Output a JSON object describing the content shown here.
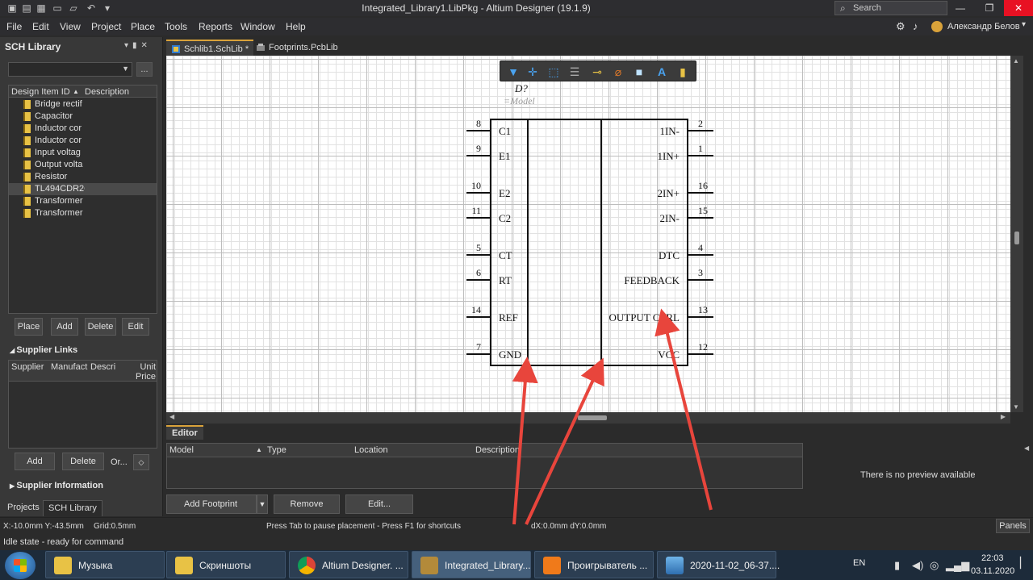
{
  "window": {
    "title": "Integrated_Library1.LibPkg - Altium Designer (19.1.9)",
    "search_placeholder": "Search",
    "min": "—",
    "restore": "❐",
    "close": "✕"
  },
  "menu": {
    "items": [
      "File",
      "Edit",
      "View",
      "Project",
      "Place",
      "Tools",
      "Reports",
      "Window",
      "Help"
    ],
    "user": "Александр Белов"
  },
  "left_panel": {
    "title": "SCH Library",
    "dots": "...",
    "columns": [
      "Design Item ID",
      "Description"
    ],
    "items": [
      "Bridge rectif",
      "Capacitor",
      "Inductor cor",
      "Inductor cor",
      "Input voltag",
      "Output volta",
      "Resistor",
      "TL494CDR2G",
      "Transformer",
      "Transformer"
    ],
    "selected_index": 7,
    "buttons": [
      "Place",
      "Add",
      "Delete",
      "Edit"
    ],
    "supplier_links": "Supplier Links",
    "supplier_columns": [
      "Supplier",
      "Manufact",
      "Descri",
      "Unit Price"
    ],
    "supplier_buttons": [
      "Add",
      "Delete",
      "Or..."
    ],
    "supplier_info": "Supplier Information",
    "tabs": [
      "Projects",
      "SCH Library"
    ]
  },
  "doc_tabs": [
    "Schlib1.SchLib *",
    "Footprints.PcbLib"
  ],
  "component": {
    "designator": "D?",
    "model": "=Model",
    "left_pins": [
      {
        "num": "8",
        "name": "C1"
      },
      {
        "num": "9",
        "name": "E1"
      },
      {
        "num": "10",
        "name": "E2"
      },
      {
        "num": "11",
        "name": "C2"
      },
      {
        "num": "5",
        "name": "CT"
      },
      {
        "num": "6",
        "name": "RT"
      },
      {
        "num": "14",
        "name": "REF"
      },
      {
        "num": "7",
        "name": "GND"
      }
    ],
    "right_pins": [
      {
        "num": "2",
        "name": "1IN-"
      },
      {
        "num": "1",
        "name": "1IN+"
      },
      {
        "num": "16",
        "name": "2IN+"
      },
      {
        "num": "15",
        "name": "2IN-"
      },
      {
        "num": "4",
        "name": "DTC"
      },
      {
        "num": "3",
        "name": "FEEDBACK"
      },
      {
        "num": "13",
        "name": "OUTPUT CTRL"
      },
      {
        "num": "12",
        "name": "VCC"
      }
    ]
  },
  "editor": {
    "tab": "Editor",
    "columns": [
      "Model",
      "Type",
      "Location",
      "Description"
    ],
    "no_preview": "There is no preview available",
    "buttons": [
      "Add Footprint",
      "Remove",
      "Edit..."
    ]
  },
  "status": {
    "coords": "X:-10.0mm Y:-43.5mm",
    "grid": "Grid:0.5mm",
    "hint": "Press Tab to pause placement - Press F1 for shortcuts",
    "delta": "dX:0.0mm dY:0.0mm",
    "panels": "Panels",
    "idle": "Idle state - ready for command"
  },
  "taskbar": {
    "items": [
      "Музыка",
      "Скриншоты",
      "Altium Designer. ...",
      "Integrated_Library...",
      "Проигрыватель ...",
      "2020-11-02_06-37...."
    ],
    "active_index": 3,
    "lang": "EN",
    "time": "22:03",
    "date": "03.11.2020"
  },
  "colors": {
    "accent": "#d9a23a",
    "annotation_arrow": "#e8453c"
  }
}
